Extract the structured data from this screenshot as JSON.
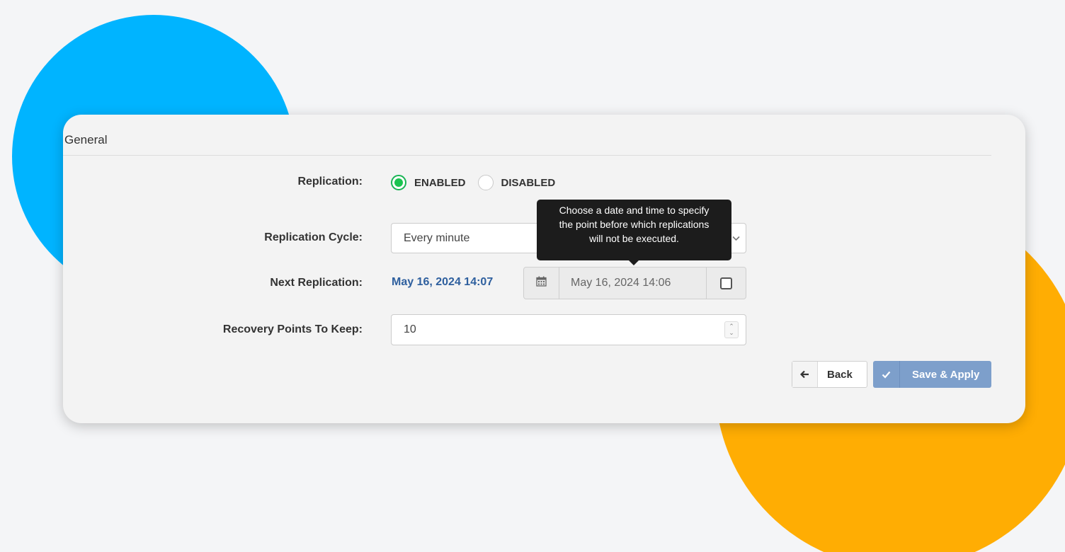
{
  "colors": {
    "background": "#f4f5f7",
    "blob_blue": "#00b4ff",
    "blob_orange": "#ffad03",
    "accent_green": "#19c34f",
    "link_blue": "#2e5f9e",
    "save_button": "#7d9fcb"
  },
  "section": {
    "title": "General"
  },
  "fields": {
    "replication": {
      "label": "Replication:",
      "options": [
        {
          "label": "ENABLED",
          "selected": true
        },
        {
          "label": "DISABLED",
          "selected": false
        }
      ]
    },
    "replication_cycle": {
      "label": "Replication Cycle:",
      "value": "Every minute",
      "icon": "chevron-down-icon"
    },
    "next_replication": {
      "label": "Next Replication:",
      "value": "May 16, 2024 14:07",
      "datetime_value": "May 16, 2024 14:06",
      "calendar_icon": "calendar-icon",
      "checkbox_checked": false
    },
    "recovery_points": {
      "label": "Recovery Points To Keep:",
      "value": "10"
    }
  },
  "tooltip": {
    "line1": "Choose a date and time to specify",
    "line2": "the point before which replications",
    "line3": "will not be executed."
  },
  "buttons": {
    "back": {
      "label": "Back",
      "icon": "arrow-left-icon"
    },
    "save": {
      "label": "Save & Apply",
      "icon": "check-icon"
    }
  }
}
